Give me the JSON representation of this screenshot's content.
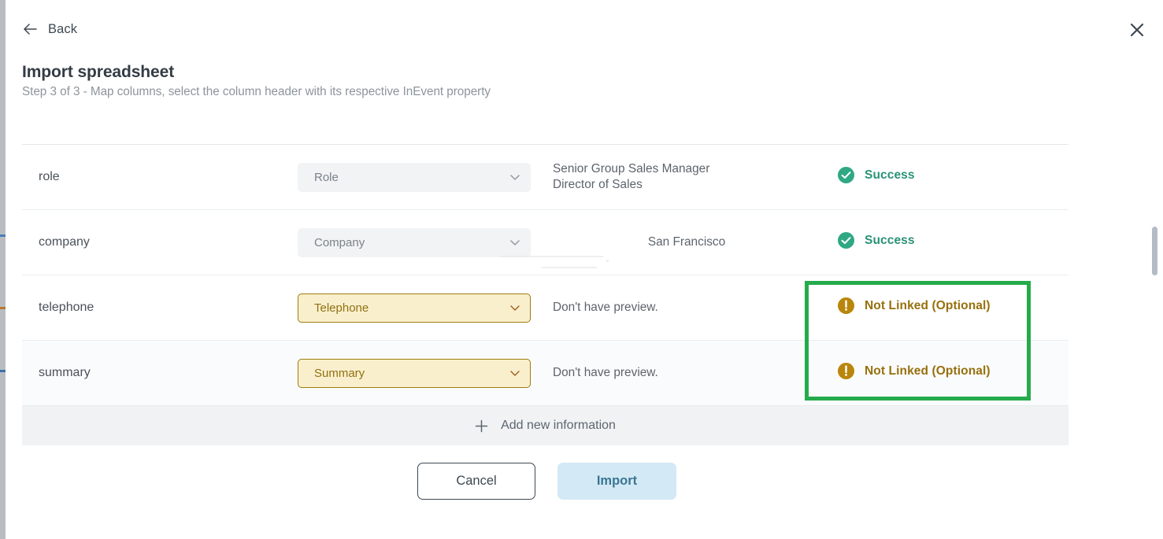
{
  "header": {
    "back_label": "Back",
    "back_icon": "arrow-left-icon",
    "close_icon": "close-icon",
    "title": "Import spreadsheet",
    "subtitle": "Step 3 of 3 - Map columns, select the column header with its respective InEvent property"
  },
  "colors": {
    "success": "#2a9275",
    "warning": "#97700c",
    "annotation": "#25ab4b",
    "warn_field_bg": "#faefcd",
    "warn_field_border": "#9c7d10",
    "field_bg": "#f1f3f5",
    "import_bg": "#d3e9f5",
    "import_text": "#3a7693"
  },
  "table": {
    "rows": [
      {
        "name": "role",
        "select_value": "Role",
        "select_state": "normal",
        "preview": "Senior Group Sales Manager\nDirector of Sales",
        "preview_align": "left",
        "status_text": "Success",
        "status_state": "ok",
        "status_icon": "check-circle-icon",
        "striped": false
      },
      {
        "name": "company",
        "select_value": "Company",
        "select_state": "normal",
        "preview": "San Francisco",
        "preview_align": "center",
        "status_text": "Success",
        "status_state": "ok",
        "status_icon": "check-circle-icon",
        "striped": false
      },
      {
        "name": "telephone",
        "select_value": "Telephone",
        "select_state": "warn",
        "preview": "Don't have preview.",
        "preview_align": "left",
        "status_text": "Not Linked (Optional)",
        "status_state": "warn",
        "status_icon": "warning-circle-icon",
        "striped": false
      },
      {
        "name": "summary",
        "select_value": "Summary",
        "select_state": "warn",
        "preview": "Don't have preview.",
        "preview_align": "left",
        "status_text": "Not Linked (Optional)",
        "status_state": "warn",
        "status_icon": "warning-circle-icon",
        "striped": true
      }
    ],
    "add_row": {
      "label": "Add new information",
      "icon": "plus-icon"
    }
  },
  "footer": {
    "cancel_label": "Cancel",
    "import_label": "Import"
  }
}
